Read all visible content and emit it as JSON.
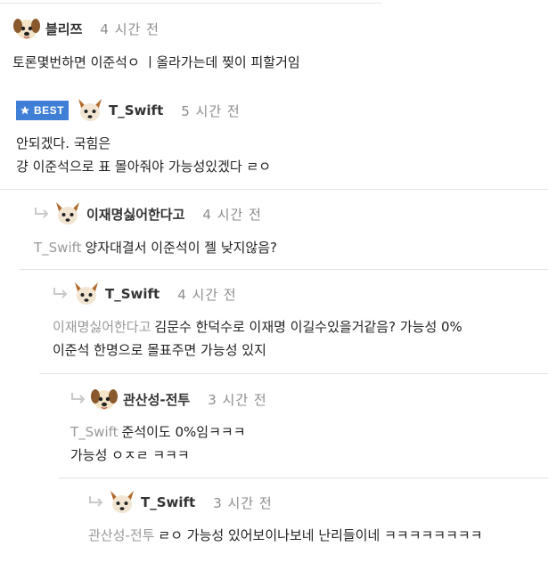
{
  "comments": [
    {
      "nickname": "블리쯔",
      "time": "4 시간 전",
      "lines": [
        "토론몇번하면 이준석ㅇ ㅣ올라가는데 찢이 피할거임"
      ]
    },
    {
      "badge": "BEST",
      "nickname": "T_Swift",
      "time": "5 시간 전",
      "lines": [
        "안되겠다. 국힘은",
        "걍 이준석으로 표 몰아줘야 가능성있겠다 ㄹㅇ"
      ]
    },
    {
      "nickname": "이재명싫어한다고",
      "time": "4 시간 전",
      "mention": "T_Swift",
      "lines": [
        "양자대결서 이준석이 젤 낮지않음?"
      ]
    },
    {
      "nickname": "T_Swift",
      "time": "4 시간 전",
      "mention": "이재명싫어한다고",
      "lines": [
        "김문수 한덕수로 이재명 이길수있을거같음? 가능성 0%",
        "이준석 한명으로 몰표주면 가능성 있지"
      ]
    },
    {
      "nickname": "관산성-전투",
      "time": "3 시간 전",
      "mention": "T_Swift",
      "lines": [
        "준석이도 0%임ㅋㅋㅋ",
        "가능성 ㅇㅈㄹ ㅋㅋㅋ"
      ]
    },
    {
      "nickname": "T_Swift",
      "time": "3 시간 전",
      "mention": "관산성-전투",
      "lines": [
        "ㄹㅇ 가능성 있어보이나보네 난리들이네 ㅋㅋㅋㅋㅋㅋㅋㅋ"
      ]
    }
  ],
  "icons": {
    "best_badge": "star-icon",
    "reply": "reply-arrow-icon",
    "avatar_dog": "dog-avatar-icon",
    "avatar_fox": "fox-avatar-icon"
  },
  "colors": {
    "best_badge_bg": "#3f7fd6",
    "mention": "#999999",
    "time": "#8c8c8c"
  }
}
